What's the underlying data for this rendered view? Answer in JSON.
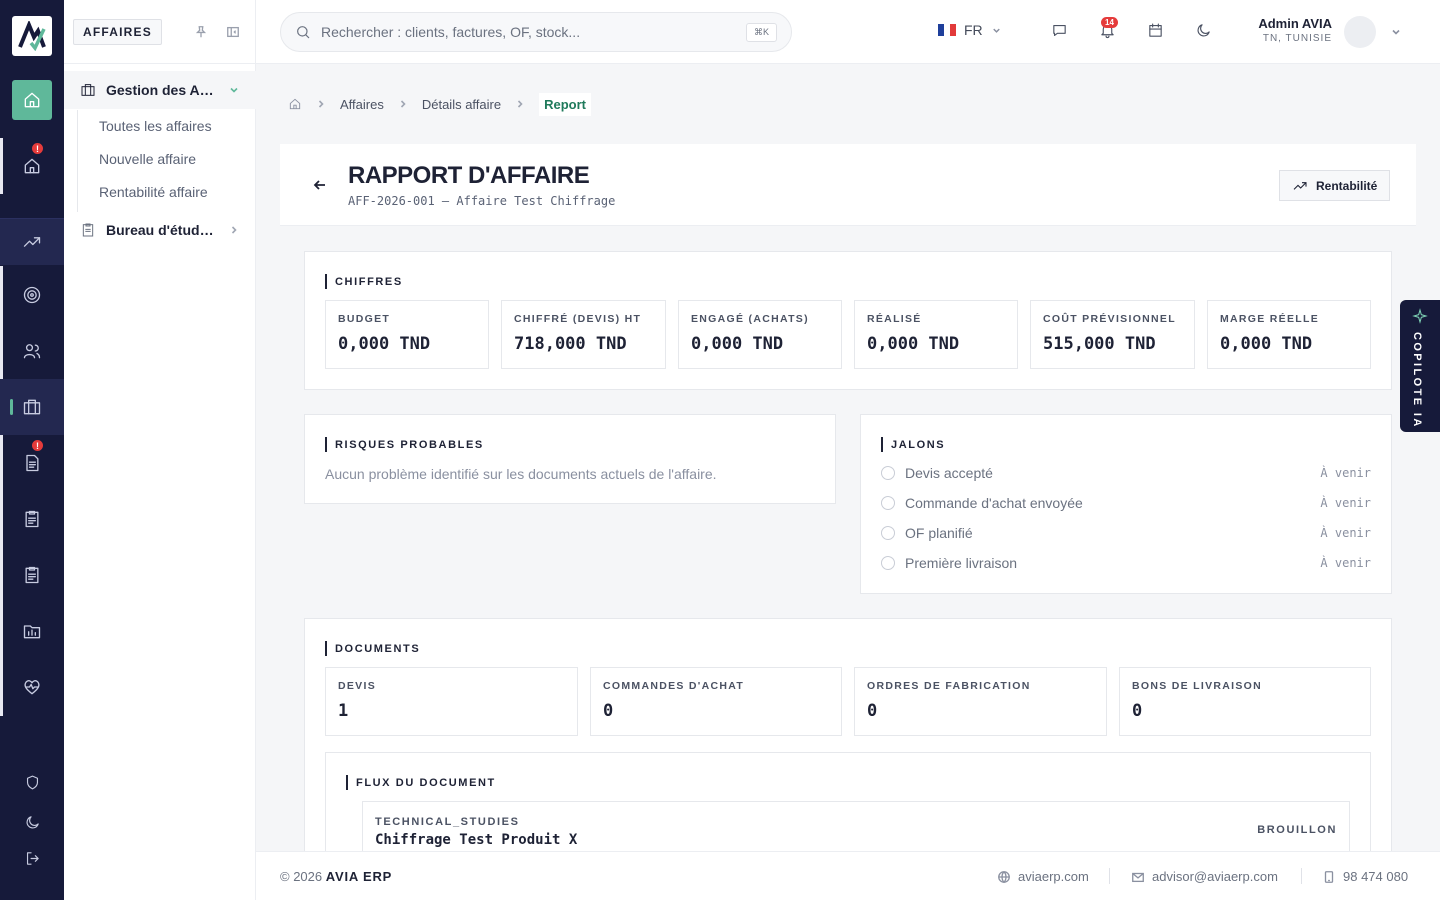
{
  "sidebar": {
    "tag": "AFFAIRES",
    "groups": [
      {
        "label": "Gestion des Affaires"
      },
      {
        "label": "Bureau d'études"
      }
    ],
    "items": [
      "Toutes les affaires",
      "Nouvelle affaire",
      "Rentabilité affaire"
    ]
  },
  "rail": {
    "badge_1": "!",
    "badge_2": "!"
  },
  "header": {
    "search_placeholder": "Rechercher : clients, factures, OF, stock...",
    "search_shortcut": "⌘K",
    "language": "FR",
    "notifications_count": "14",
    "user_name": "Admin AVIA",
    "user_location": "TN, TUNISIE"
  },
  "breadcrumb": [
    "Affaires",
    "Détails affaire",
    "Report"
  ],
  "page": {
    "title": "RAPPORT D'AFFAIRE",
    "subtitle": "AFF-2026-001 — Affaire Test Chiffrage",
    "action_label": "Rentabilité"
  },
  "chiffres": {
    "title": "CHIFFRES",
    "kpis": [
      {
        "label": "BUDGET",
        "value": "0,000 TND"
      },
      {
        "label": "CHIFFRÉ (DEVIS) HT",
        "value": "718,000 TND"
      },
      {
        "label": "ENGAGÉ (ACHATS)",
        "value": "0,000 TND"
      },
      {
        "label": "RÉALISÉ",
        "value": "0,000 TND"
      },
      {
        "label": "COÛT PRÉVISIONNEL",
        "value": "515,000 TND"
      },
      {
        "label": "MARGE RÉELLE",
        "value": "0,000 TND"
      }
    ]
  },
  "risques": {
    "title": "RISQUES PROBABLES",
    "text": "Aucun problème identifié sur les documents actuels de l'affaire."
  },
  "jalons": {
    "title": "JALONS",
    "items": [
      {
        "label": "Devis accepté",
        "status": "À venir"
      },
      {
        "label": "Commande d'achat envoyée",
        "status": "À venir"
      },
      {
        "label": "OF planifié",
        "status": "À venir"
      },
      {
        "label": "Première livraison",
        "status": "À venir"
      }
    ]
  },
  "documents": {
    "title": "DOCUMENTS",
    "counts": [
      {
        "label": "DEVIS",
        "value": "1"
      },
      {
        "label": "COMMANDES D'ACHAT",
        "value": "0"
      },
      {
        "label": "ORDRES DE FABRICATION",
        "value": "0"
      },
      {
        "label": "BONS DE LIVRAISON",
        "value": "0"
      }
    ],
    "flux_title": "FLUX DU DOCUMENT",
    "flux_item": {
      "type": "TECHNICAL_STUDIES",
      "name": "Chiffrage Test Produit X",
      "status": "BROUILLON"
    }
  },
  "copilot": {
    "label": "COPILOTE IA"
  },
  "footer": {
    "year": "© 2026",
    "brand": "AVIA ERP",
    "website": "aviaerp.com",
    "email": "advisor@aviaerp.com",
    "phone": "98 474 080"
  },
  "colors": {
    "accent": "#5fb89a",
    "rail": "#161a3a",
    "breadcrumb_active": "#1f7a5b",
    "badge": "#e53b3b"
  }
}
